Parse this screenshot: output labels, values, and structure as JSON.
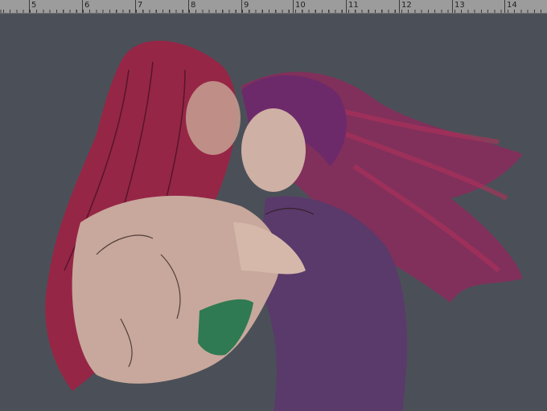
{
  "ruler": {
    "labels": [
      "5",
      "6",
      "7",
      "8",
      "9",
      "10",
      "11",
      "12",
      "13",
      "14"
    ]
  },
  "artwork": {
    "description_icon": "painting-canvas"
  },
  "colors": {
    "canvas_background": "#4b5058",
    "ruler_background": "#9c9c9c",
    "hair_left": "#9e2145",
    "hair_right": "#6d2a6a",
    "skin": "#c8a89c",
    "jacket": "#5a3a6a",
    "bracelet": "#2f7a52"
  }
}
